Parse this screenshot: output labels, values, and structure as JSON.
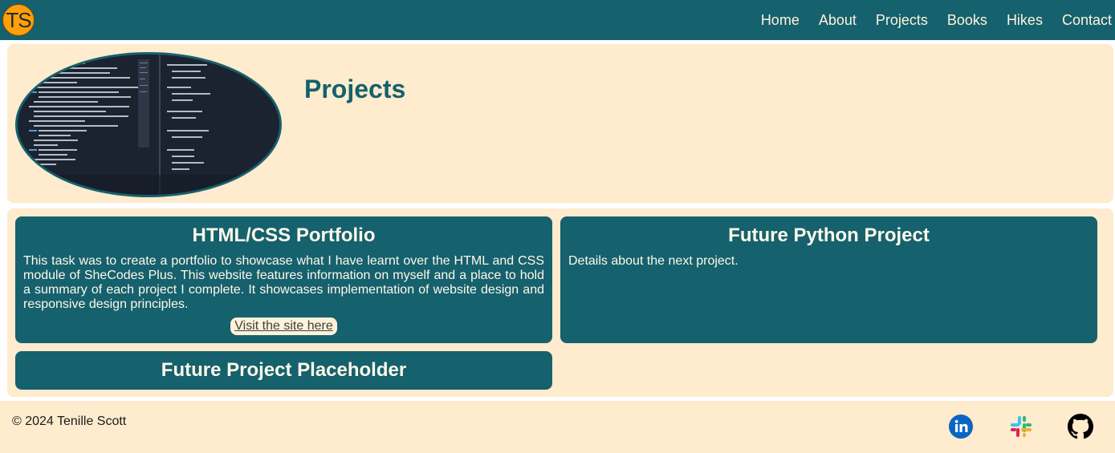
{
  "header": {
    "logo_text": "TS",
    "nav": [
      {
        "label": "Home"
      },
      {
        "label": "About"
      },
      {
        "label": "Projects"
      },
      {
        "label": "Books"
      },
      {
        "label": "Hikes"
      },
      {
        "label": "Contact"
      }
    ]
  },
  "hero": {
    "title": "Projects",
    "image": "code-screen-photo"
  },
  "projects": [
    {
      "title": "HTML/CSS Portfolio",
      "description": "This task was to create a portfolio to showcase what I have learnt over the HTML and CSS module of SheCodes Plus. This website features information on myself and a place to hold a summary of each project I complete. It showcases implementation of website design and responsive design principles.",
      "link_label": "Visit the site here"
    },
    {
      "title": "Future Python Project",
      "description": "Details about the next project."
    },
    {
      "title": "Future Project Placeholder"
    }
  ],
  "footer": {
    "copyright": "© 2024 Tenille Scott",
    "social": [
      {
        "icon": "linkedin-icon",
        "color": "#0a66c2"
      },
      {
        "icon": "slack-icon"
      },
      {
        "icon": "github-icon",
        "color": "#000000"
      }
    ]
  },
  "colors": {
    "primary": "#15616d",
    "background": "#ffebcd",
    "logo": "#ff9f0a"
  }
}
